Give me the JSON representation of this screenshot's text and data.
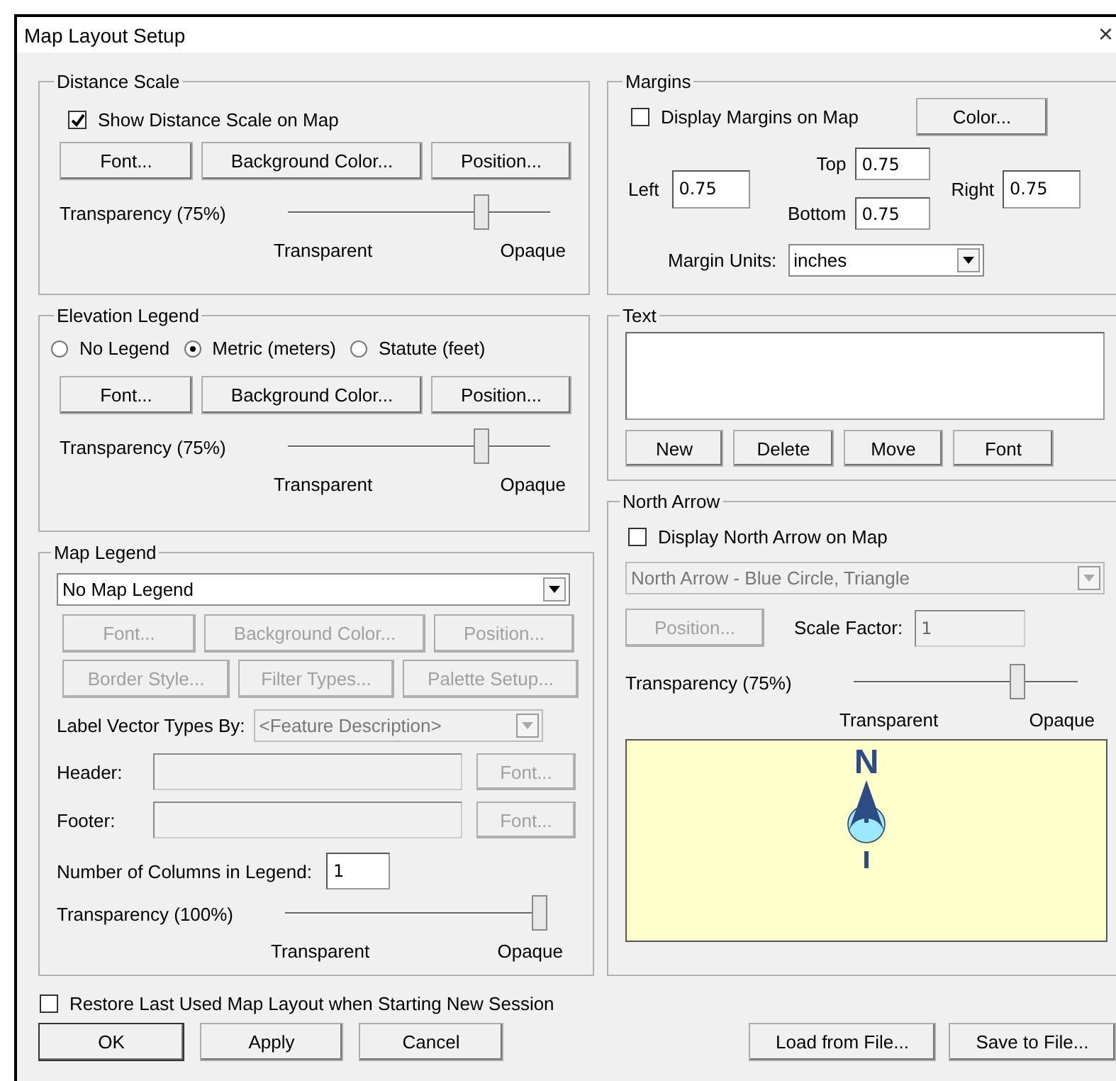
{
  "window": {
    "title": "Map Layout Setup",
    "close": "×"
  },
  "distance_scale": {
    "title": "Distance Scale",
    "show": {
      "label": "Show Distance Scale on Map",
      "checked": true
    },
    "buttons": [
      {
        "label": "Font...",
        "disabled": false
      },
      {
        "label": "Background Color...",
        "disabled": false
      },
      {
        "label": "Position...",
        "disabled": false
      }
    ],
    "transparency": {
      "label": "Transparency (75%)",
      "level": 0.75,
      "min_label": "Transparent",
      "max_label": "Opaque"
    }
  },
  "elevation_legend": {
    "title": "Elevation Legend",
    "options": [
      {
        "label": "No Legend",
        "selected": false
      },
      {
        "label": "Metric (meters)",
        "selected": true
      },
      {
        "label": "Statute (feet)",
        "selected": false
      }
    ],
    "buttons": [
      {
        "label": "Font...",
        "disabled": false
      },
      {
        "label": "Background Color...",
        "disabled": false
      },
      {
        "label": "Position...",
        "disabled": false
      }
    ],
    "transparency": {
      "label": "Transparency (75%)",
      "level": 0.75,
      "min_label": "Transparent",
      "max_label": "Opaque"
    }
  },
  "map_legend": {
    "title": "Map Legend",
    "dropdown": {
      "value": "No Map Legend",
      "disabled": false
    },
    "buttons": [
      {
        "label": "Font...",
        "disabled": true
      },
      {
        "label": "Background Color...",
        "disabled": true
      },
      {
        "label": "Position...",
        "disabled": true
      }
    ],
    "buttons_2": [
      {
        "label": "Border Style...",
        "disabled": true
      },
      {
        "label": "Filter Types...",
        "disabled": true
      },
      {
        "label": "Palette Setup...",
        "disabled": true
      }
    ],
    "label_vector_types": {
      "label": "Label Vector Types By:",
      "value": "<Feature Description>",
      "disabled": true
    },
    "header": {
      "label": "Header:",
      "disabled": true,
      "font_button": "Font..."
    },
    "footer": {
      "label": "Footer:",
      "disabled": true,
      "font_button": "Font..."
    },
    "columns": {
      "label": "Number of Columns in Legend:",
      "value": "1"
    },
    "transparency": {
      "label": "Transparency (100%)",
      "level": 1,
      "min_label": "Transparent",
      "max_label": "Opaque"
    }
  },
  "margins": {
    "title": "Margins",
    "display": {
      "label": "Display Margins on Map",
      "checked": false
    },
    "color_button": "Color...",
    "left": {
      "label": "Left",
      "value": "0.75"
    },
    "top": {
      "label": "Top",
      "value": "0.75"
    },
    "bottom": {
      "label": "Bottom",
      "value": "0.75"
    },
    "right": {
      "label": "Right",
      "value": "0.75"
    },
    "units": {
      "label": "Margin Units:",
      "value": "inches",
      "disabled": false
    }
  },
  "text": {
    "title": "Text",
    "buttons": [
      "New",
      "Delete",
      "Move",
      "Font"
    ]
  },
  "north_arrow": {
    "title": "North Arrow",
    "display": {
      "label": "Display North Arrow on Map",
      "checked": false
    },
    "style": {
      "value": "North Arrow - Blue Circle, Triangle",
      "disabled": true
    },
    "position_button": {
      "label": "Position...",
      "disabled": true
    },
    "scale_factor": {
      "label": "Scale Factor:",
      "value": "1",
      "disabled": true
    },
    "transparency": {
      "label": "Transparency (75%)",
      "level": 0.75,
      "min_label": "Transparent",
      "max_label": "Opaque"
    },
    "preview": {
      "letter": "N"
    }
  },
  "restore": {
    "label": "Restore Last Used Map Layout when Starting New Session",
    "checked": false
  },
  "buttons": [
    {
      "label": "OK",
      "default": true
    },
    {
      "label": "Apply",
      "default": false
    },
    {
      "label": "Cancel",
      "default": false
    }
  ],
  "file_buttons": [
    "Load from File...",
    "Save to File..."
  ]
}
